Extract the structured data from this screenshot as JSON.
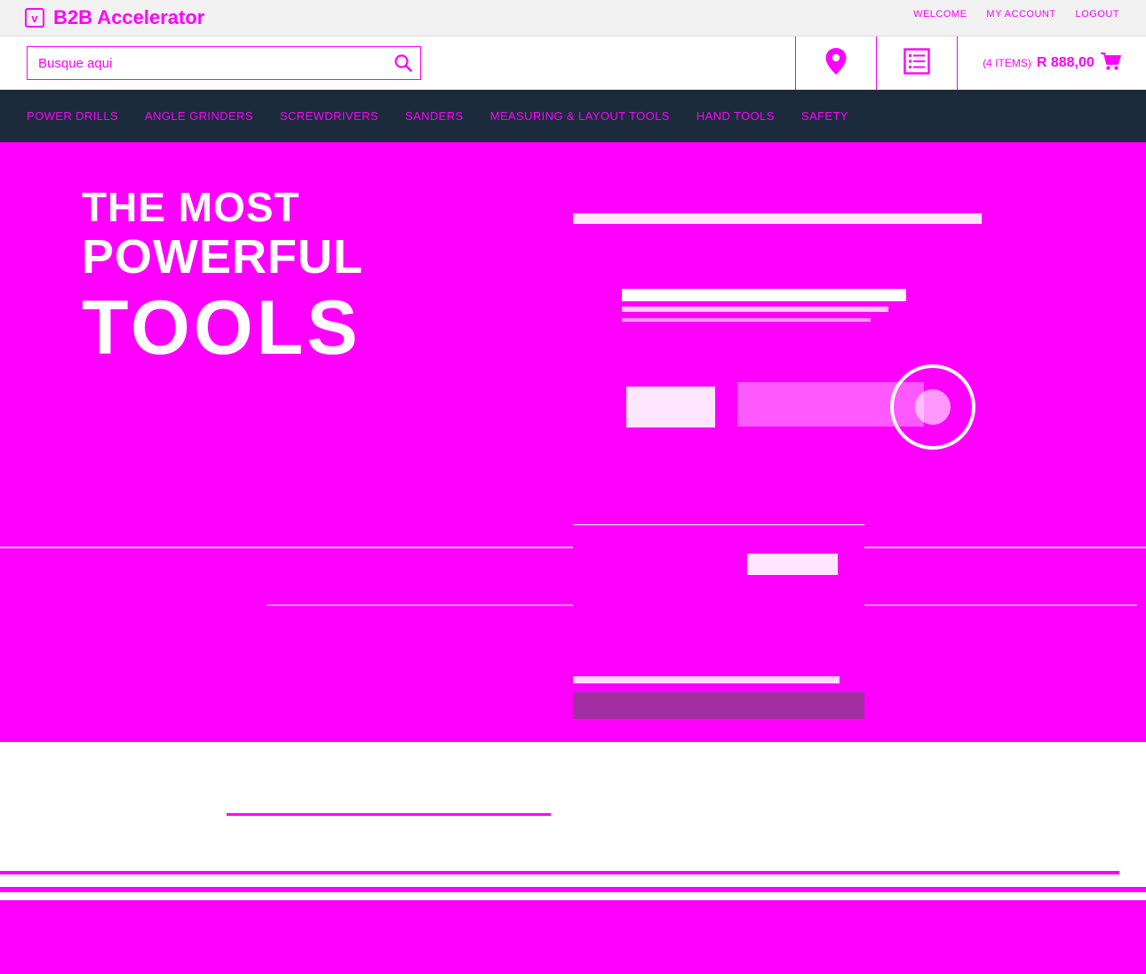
{
  "brand": {
    "name": "B2B Accelerator",
    "mark": "v",
    "color": "#ff00ff"
  },
  "top_links": [
    "WELCOME",
    "MY ACCOUNT",
    "LOGOUT"
  ],
  "search": {
    "placeholder": "Busque aqui",
    "icon": "search-icon"
  },
  "utility": {
    "location_icon": "map-pin-icon",
    "list_icon": "list-icon"
  },
  "cart": {
    "items_label": "(4 ITEMS)",
    "total": "R 888,00",
    "icon": "cart-icon"
  },
  "categories": [
    "POWER DRILLS",
    "ANGLE GRINDERS",
    "SCREWDRIVERS",
    "SANDERS",
    "MEASURING & LAYOUT TOOLS",
    "HAND TOOLS",
    "SAFETY"
  ],
  "hero": {
    "line1": "THE MOST",
    "line2": "POWERFUL",
    "line3": "TOOLS"
  },
  "colors": {
    "accent": "#ff00ff",
    "nav_bg": "#1b2b3c",
    "topbar_bg": "#f2f2f2"
  }
}
